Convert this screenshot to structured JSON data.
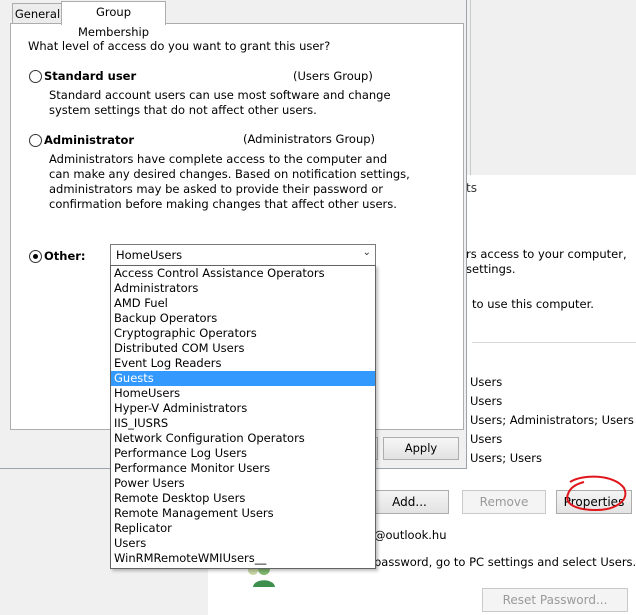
{
  "background": {
    "tab_fragment": "ts",
    "text_lines": [
      "rs access to your computer,",
      "settings.",
      "to use this computer."
    ],
    "group_rows": [
      "Users",
      "Users",
      "Users; Administrators; Users",
      "Users",
      "Users; Users"
    ],
    "add_label": "Add...",
    "remove_label": "Remove",
    "properties_label": "Properties",
    "email_fragment": "@outlook.hu",
    "password_hint": "password, go to PC settings and select Users.",
    "reset_password_label": "Reset Password..."
  },
  "dialog": {
    "tabs": [
      {
        "label": "General",
        "active": false
      },
      {
        "label": "Group Membership",
        "active": true
      }
    ],
    "question": "What level of access do you want to grant this user?",
    "standard": {
      "label": "Standard user",
      "group": "(Users Group)",
      "desc1": "Standard account users can use most software and change",
      "desc2": "system settings that do not affect other users.",
      "selected": false
    },
    "administrator": {
      "label": "Administrator",
      "group": "(Administrators Group)",
      "desc1": "Administrators have complete access to the computer and",
      "desc2": "can make any desired changes. Based on notification settings,",
      "desc3": "administrators may be asked to provide their password or",
      "desc4": "confirmation before making changes that affect other users.",
      "selected": false
    },
    "other": {
      "label": "Other:",
      "selected": true,
      "combo_value": "HomeUsers"
    },
    "apply_label": "Apply"
  },
  "dropdown": {
    "selected_index": 7,
    "options": [
      "Access Control Assistance Operators",
      "Administrators",
      "AMD Fuel",
      "Backup Operators",
      "Cryptographic Operators",
      "Distributed COM Users",
      "Event Log Readers",
      "Guests",
      "HomeUsers",
      "Hyper-V Administrators",
      "IIS_IUSRS",
      "Network Configuration Operators",
      "Performance Log Users",
      "Performance Monitor Users",
      "Power Users",
      "Remote Desktop Users",
      "Remote Management Users",
      "Replicator",
      "Users",
      "WinRMRemoteWMIUsers__"
    ]
  },
  "colors": {
    "selection": "#3399ff",
    "annotation": "#e0151b"
  }
}
